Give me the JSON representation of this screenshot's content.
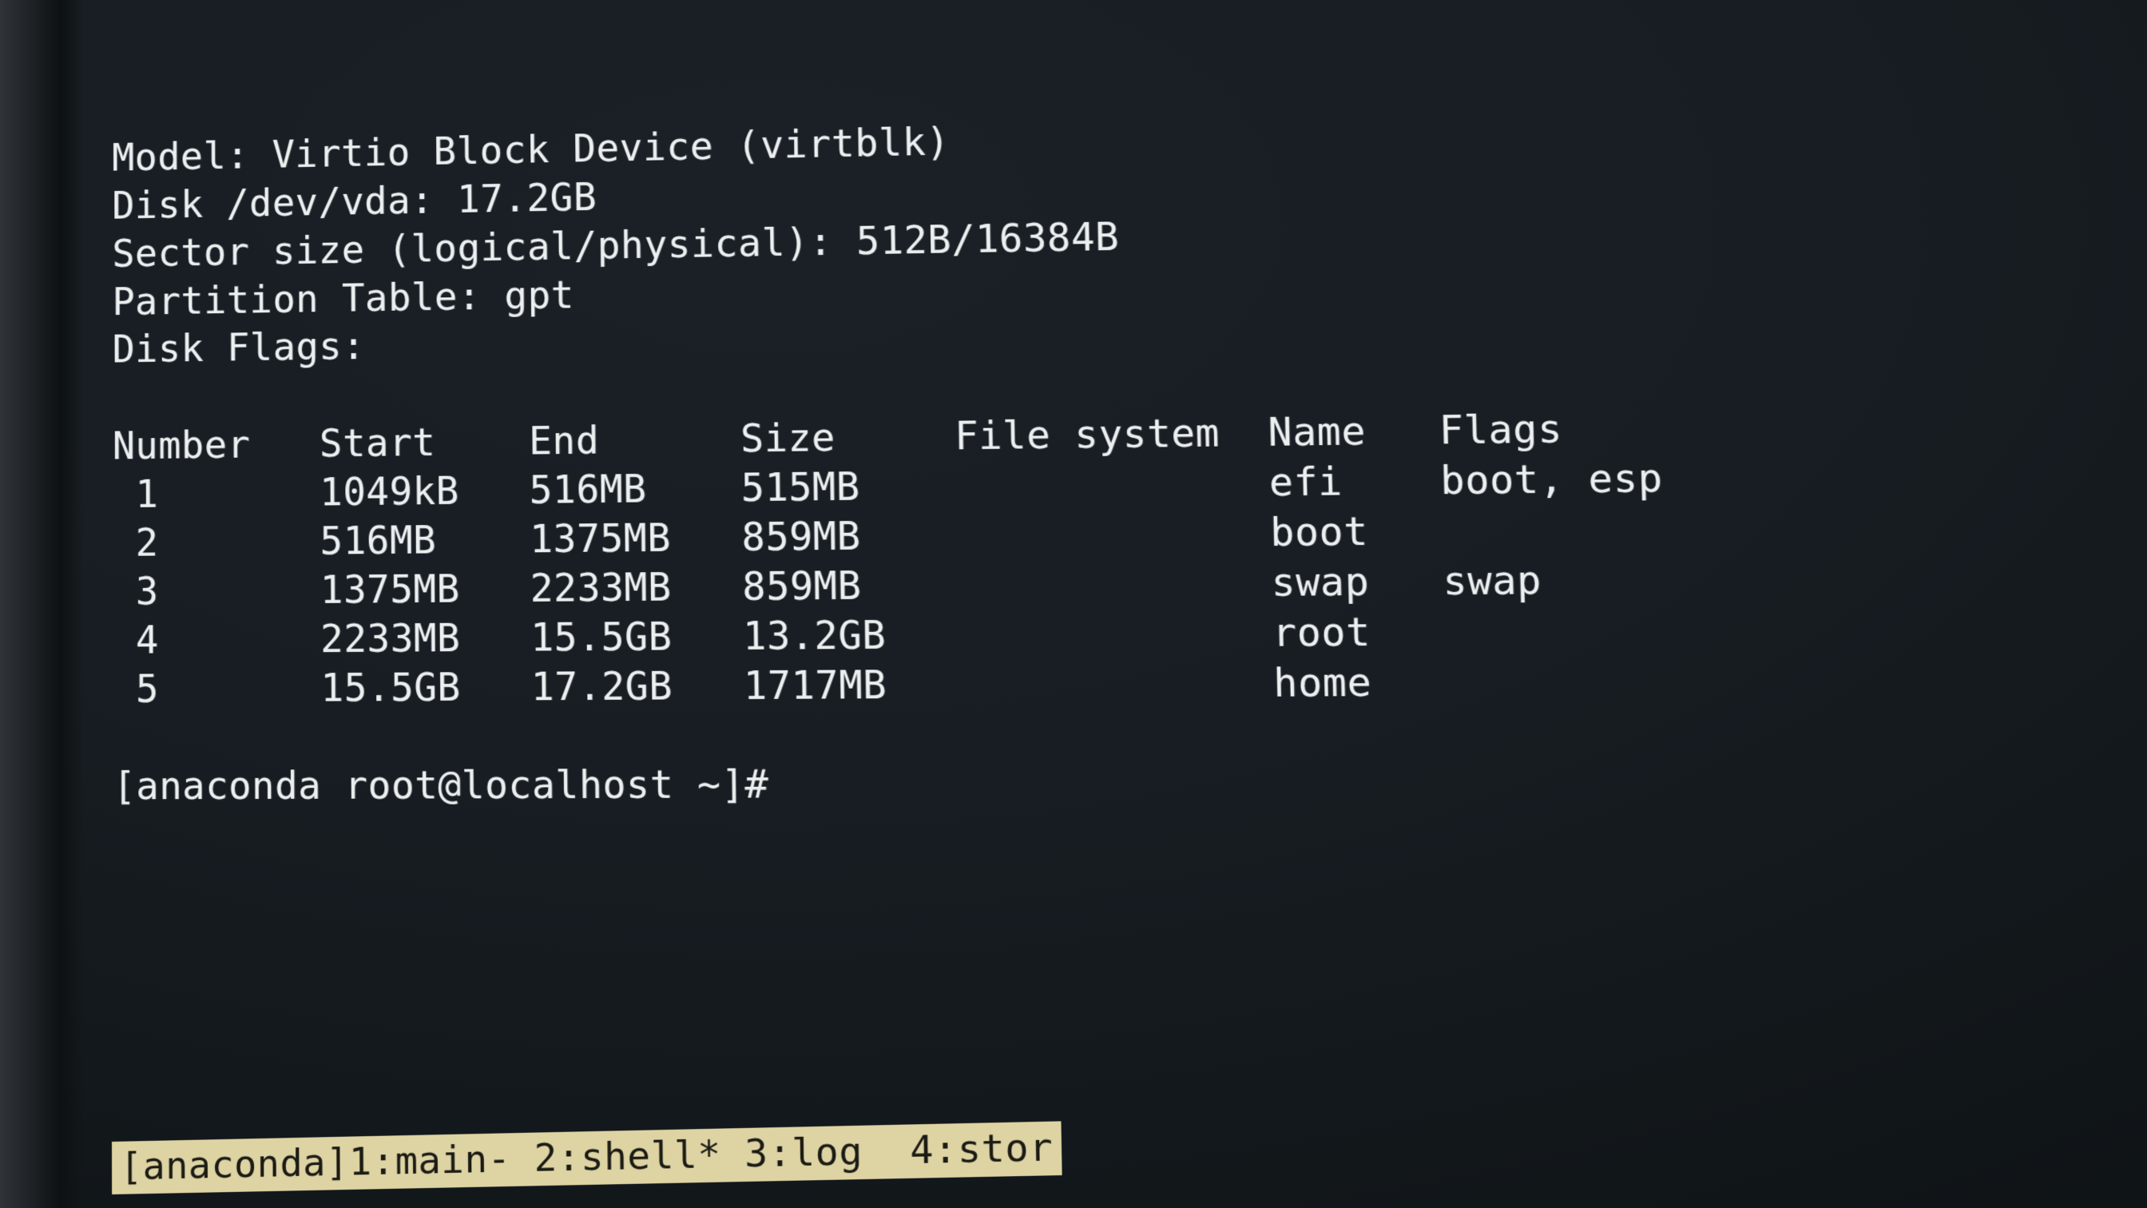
{
  "header": {
    "model_label": "Model:",
    "model_value": "Virtio Block Device (virtblk)",
    "disk_label": "Disk",
    "disk_path": "/dev/vda:",
    "disk_size": "17.2GB",
    "sector_label": "Sector size (logical/physical):",
    "sector_value": "512B/16384B",
    "pt_label": "Partition Table:",
    "pt_value": "gpt",
    "diskflags_label": "Disk Flags:"
  },
  "columns": {
    "number": "Number",
    "start": "Start",
    "end": "End",
    "size": "Size",
    "fs": "File system",
    "name": "Name",
    "flags": "Flags"
  },
  "rows": [
    {
      "num": "1",
      "start": "1049kB",
      "end": "516MB",
      "size": "515MB",
      "fs": "",
      "name": "efi",
      "flags": "boot, esp"
    },
    {
      "num": "2",
      "start": "516MB",
      "end": "1375MB",
      "size": "859MB",
      "fs": "",
      "name": "boot",
      "flags": ""
    },
    {
      "num": "3",
      "start": "1375MB",
      "end": "2233MB",
      "size": "859MB",
      "fs": "",
      "name": "swap",
      "flags": "swap"
    },
    {
      "num": "4",
      "start": "2233MB",
      "end": "15.5GB",
      "size": "13.2GB",
      "fs": "",
      "name": "root",
      "flags": ""
    },
    {
      "num": "5",
      "start": "15.5GB",
      "end": "17.2GB",
      "size": "1717MB",
      "fs": "",
      "name": "home",
      "flags": ""
    }
  ],
  "prompt": "[anaconda root@localhost ~]#",
  "tmux_status": "[anaconda]1:main- 2:shell* 3:log  4:stor",
  "cols": {
    "num_off": 1,
    "start": 9,
    "end": 18,
    "size": 27,
    "fs": 36,
    "name": 49,
    "flags": 56
  }
}
